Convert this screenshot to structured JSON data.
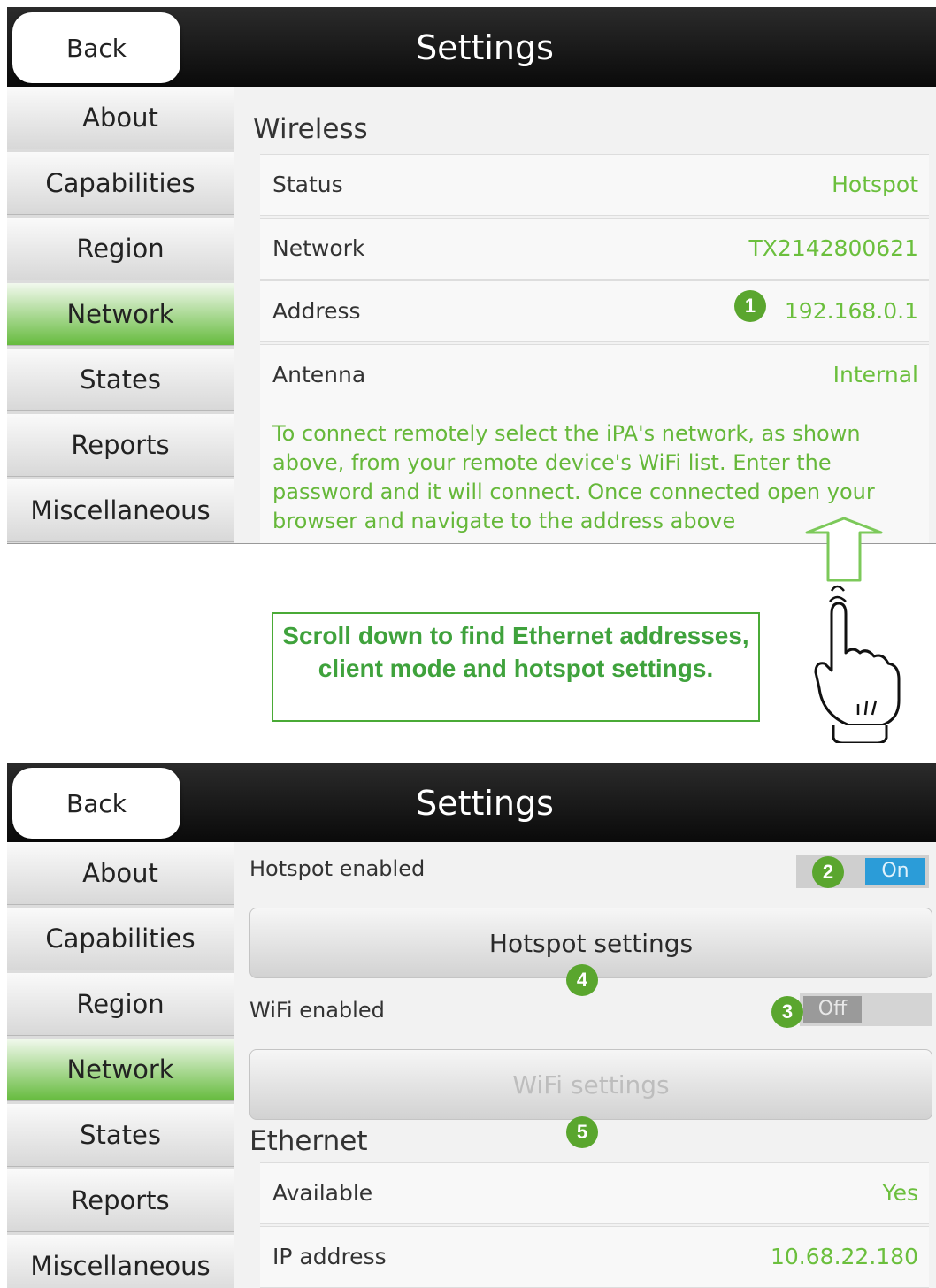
{
  "header": {
    "back_label": "Back",
    "title": "Settings"
  },
  "sidebar": {
    "items": [
      "About",
      "Capabilities",
      "Region",
      "Network",
      "States",
      "Reports",
      "Miscellaneous"
    ],
    "active": "Network"
  },
  "screen1": {
    "section_title": "Wireless",
    "rows": [
      {
        "label": "Status",
        "value": "Hotspot"
      },
      {
        "label": "Network",
        "value": "TX2142800621"
      },
      {
        "label": "Address",
        "value": "192.168.0.1"
      },
      {
        "label": "Antenna",
        "value": "Internal"
      }
    ],
    "info_text": "To connect remotely select the iPA's network, as shown above, from your remote device's WiFi list. Enter the password and it will connect. Once connected open your browser and navigate to the address above",
    "badge_address": "1"
  },
  "callout": {
    "text": "Scroll down to find Ethernet addresses, client mode and hotspot settings."
  },
  "screen2": {
    "hotspot_enabled_label": "Hotspot enabled",
    "hotspot_toggle_label": "On",
    "hotspot_settings_label": "Hotspot settings",
    "wifi_enabled_label": "WiFi enabled",
    "wifi_toggle_label": "Off",
    "wifi_settings_label": "WiFi settings",
    "ethernet_title": "Ethernet",
    "rows": [
      {
        "label": "Available",
        "value": "Yes"
      },
      {
        "label": "IP address",
        "value": "10.68.22.180"
      }
    ],
    "badges": [
      "2",
      "3",
      "4",
      "5"
    ]
  },
  "colors": {
    "accent_green": "#6bbf3d",
    "toggle_blue": "#2b9cd8",
    "badge_green": "#5aa62e"
  },
  "icons": [
    "hand-pointer-icon",
    "up-arrow-icon"
  ]
}
